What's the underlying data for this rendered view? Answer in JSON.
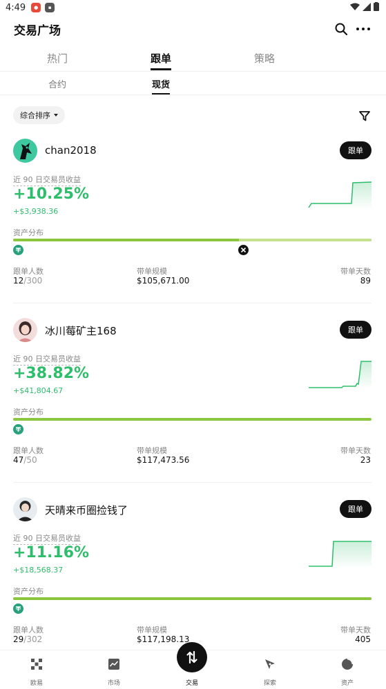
{
  "status_bar": {
    "time": "4:49"
  },
  "header": {
    "title": "交易广场"
  },
  "tabs": [
    {
      "label": "热门",
      "active": false
    },
    {
      "label": "跟单",
      "active": true
    },
    {
      "label": "策略",
      "active": false
    }
  ],
  "subtabs": [
    {
      "label": "合约",
      "active": false
    },
    {
      "label": "现货",
      "active": true
    }
  ],
  "sort": {
    "label": "综合排序"
  },
  "labels": {
    "follow": "跟单",
    "return_label": "近 90 日交易员收益",
    "allocation": "资产分布",
    "followers": "跟单人数",
    "aum": "带单规模",
    "days": "带单天数"
  },
  "traders": [
    {
      "name": "chan2018",
      "return_pct": "+10.25%",
      "return_amt": "+$3,938.36",
      "followers": "12",
      "followers_max": "/300",
      "aum": "$105,671.00",
      "days": "89",
      "allocation": [
        0.63,
        0.37
      ],
      "coins": [
        "usdt-coin-icon",
        "other-coin-icon"
      ]
    },
    {
      "name": "冰川莓矿主168",
      "return_pct": "+38.82%",
      "return_amt": "+$41,804.67",
      "followers": "47",
      "followers_max": "/50",
      "aum": "$117,473.56",
      "days": "23",
      "allocation": [
        1.0
      ],
      "coins": [
        "usdt-coin-icon"
      ]
    },
    {
      "name": "天晴来币圈捡钱了",
      "return_pct": "+11.16%",
      "return_amt": "+$18,568.37",
      "followers": "29",
      "followers_max": "/302",
      "aum": "$117,198.13",
      "days": "405",
      "allocation": [
        1.0
      ],
      "coins": [
        "usdt-coin-icon"
      ]
    }
  ],
  "bottom_nav": [
    {
      "label": "欧易",
      "icon": "okx-logo-icon"
    },
    {
      "label": "市场",
      "icon": "market-chart-icon"
    },
    {
      "label": "交易",
      "icon": "trade-arrows-icon"
    },
    {
      "label": "探索",
      "icon": "explore-icon"
    },
    {
      "label": "资产",
      "icon": "assets-pie-icon"
    }
  ],
  "colors": {
    "positive": "#2ebd6b",
    "alloc_main": "#8cc63f",
    "alloc_secondary": "#c5e08c",
    "usdt": "#26a17b"
  }
}
